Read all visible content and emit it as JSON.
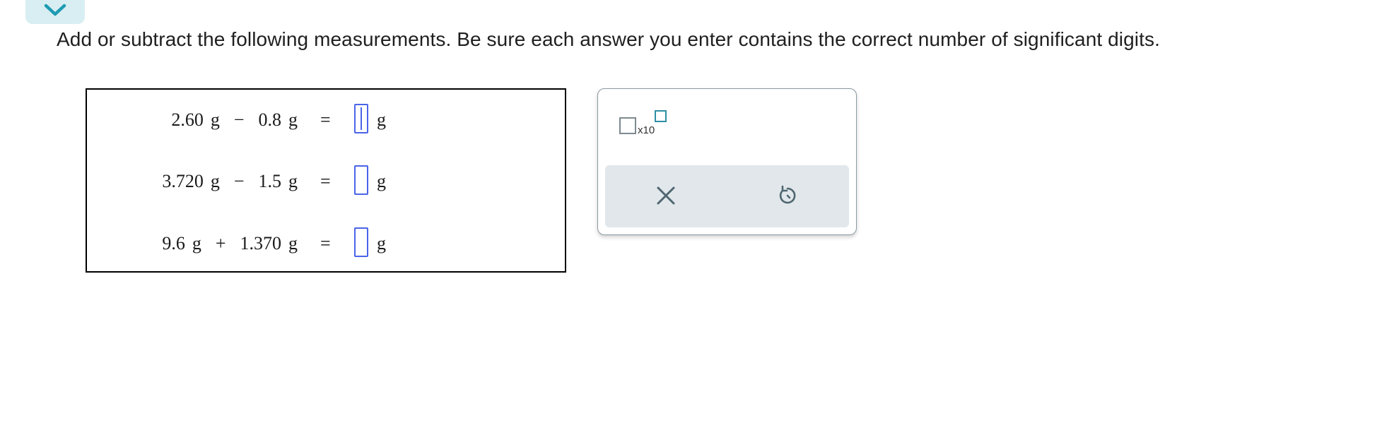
{
  "instructions": "Add or subtract the following measurements. Be sure each answer you enter contains the correct number of significant digits.",
  "problems": [
    {
      "a": "2.60",
      "a_unit": "g",
      "op": "−",
      "b": "0.8",
      "b_unit": "g",
      "equals": "=",
      "answer": "",
      "answer_unit": "g"
    },
    {
      "a": "3.720",
      "a_unit": "g",
      "op": "−",
      "b": "1.5",
      "b_unit": "g",
      "equals": "=",
      "answer": "",
      "answer_unit": "g"
    },
    {
      "a": "9.6",
      "a_unit": "g",
      "op": "+",
      "b": "1.370",
      "b_unit": "g",
      "equals": "=",
      "answer": "",
      "answer_unit": "g"
    }
  ],
  "tools": {
    "sci_notation_label": "x10",
    "clear_icon": "close-icon",
    "undo_icon": "undo-icon",
    "accent_color": "#2e8fa5",
    "input_border_color": "#4a64e8"
  },
  "collapse_icon": "chevron-down-icon"
}
